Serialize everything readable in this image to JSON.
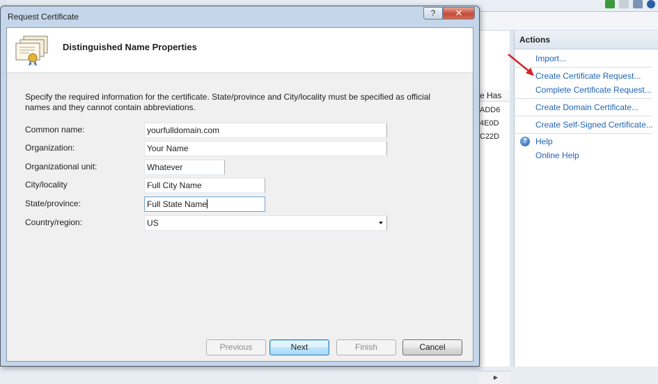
{
  "dialog": {
    "title": "Request Certificate",
    "help_glyph": "?",
    "close_glyph": "✕",
    "header_title": "Distinguished Name Properties",
    "description": "Specify the required information for the certificate. State/province and City/locality must be specified as official names and they cannot contain abbreviations.",
    "fields": {
      "common_name": {
        "label": "Common name:",
        "value": "yourfulldomain.com"
      },
      "organization": {
        "label": "Organization:",
        "value": "Your Name"
      },
      "organizational_unit": {
        "label": "Organizational unit:",
        "value": "Whatever"
      },
      "city": {
        "label": "City/locality",
        "value": "Full City Name"
      },
      "state": {
        "label": "State/province:",
        "value": "Full State Name"
      },
      "country": {
        "label": "Country/region:",
        "value": "US"
      }
    },
    "buttons": {
      "previous": "Previous",
      "next": "Next",
      "finish": "Finish",
      "cancel": "Cancel"
    }
  },
  "background": {
    "column_header": "e Has",
    "hash_rows": [
      "ADD6",
      "4E0D",
      "C22D"
    ]
  },
  "actions_pane": {
    "title": "Actions",
    "items": [
      "Import...",
      "Create Certificate Request...",
      "Complete Certificate Request...",
      "Create Domain Certificate...",
      "Create Self-Signed Certificate...",
      "Help",
      "Online Help"
    ]
  },
  "colors": {
    "link": "#2064b6",
    "close_button": "#c64a35",
    "arrow": "#d2232a"
  }
}
